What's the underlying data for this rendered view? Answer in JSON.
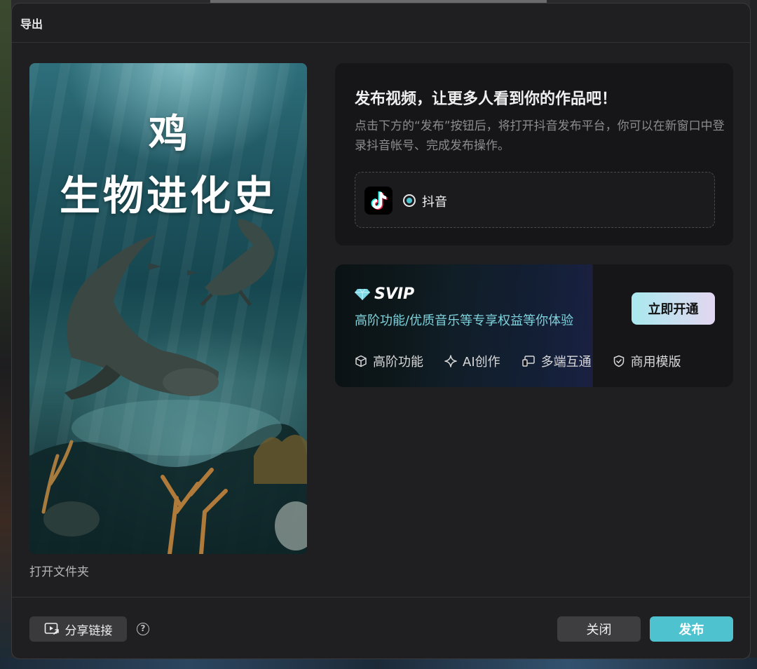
{
  "dialog": {
    "title": "导出"
  },
  "preview": {
    "title_line1": "鸡",
    "title_line2": "生物进化史",
    "open_folder": "打开文件夹"
  },
  "publish": {
    "heading": "发布视频，让更多人看到你的作品吧！",
    "description": "点击下方的“发布”按钮后，将打开抖音发布平台，你可以在新窗口中登录抖音帐号、完成发布操作。",
    "platform": {
      "label": "抖音",
      "icon": "tiktok-icon",
      "selected": true
    }
  },
  "svip": {
    "badge": "SVIP",
    "description": "高阶功能/优质音乐等专享权益等你体验",
    "cta": "立即开通",
    "features": [
      {
        "label": "高阶功能",
        "icon": "cube-icon"
      },
      {
        "label": "AI创作",
        "icon": "sparkle-icon"
      },
      {
        "label": "多端互通",
        "icon": "devices-icon"
      },
      {
        "label": "商用模版",
        "icon": "shield-check-icon"
      }
    ]
  },
  "footer": {
    "share": "分享链接",
    "help": "?",
    "close": "关闭",
    "publish": "发布"
  },
  "colors": {
    "accent": "#4fc2cf",
    "dialog_bg": "#1f1f21",
    "card_bg": "#161618"
  }
}
